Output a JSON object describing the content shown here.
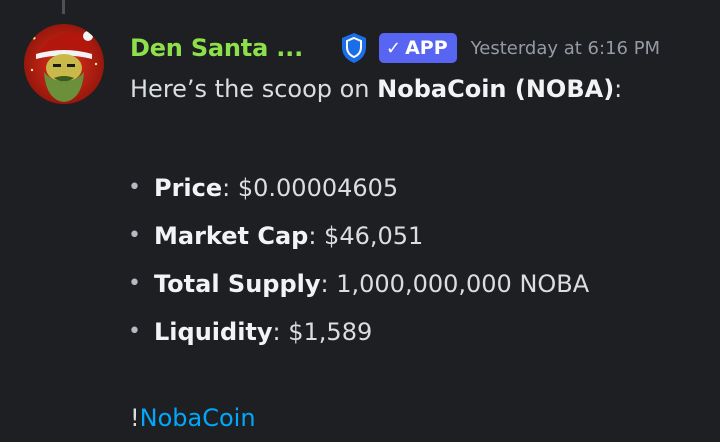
{
  "message": {
    "author": "Den Santa ...",
    "badge": "APP",
    "badge_check": "✓",
    "timestamp": "Yesterday at 6:16 PM",
    "intro_prefix": "Here’s the scoop on ",
    "intro_bold": "NobaCoin (NOBA)",
    "intro_suffix": ":",
    "stats": [
      {
        "label": "Price",
        "value": ": $0.00004605"
      },
      {
        "label": "Market Cap",
        "value": ": $46,051"
      },
      {
        "label": "Total Supply",
        "value": ": 1,000,000,000 NOBA"
      },
      {
        "label": "Liquidity",
        "value": ": $1,589"
      }
    ],
    "command_prefix": "!",
    "command_link": "NobaCoin"
  },
  "icons": {
    "avatar": "santa-avatar",
    "shield": "shield-icon",
    "bullet": "•"
  },
  "colors": {
    "background": "#1e1f22",
    "username": "#8ee04a",
    "badge": "#5865f2",
    "link": "#00a8fc",
    "shield": "#1a6fe8",
    "timestamp": "#949ba4"
  }
}
